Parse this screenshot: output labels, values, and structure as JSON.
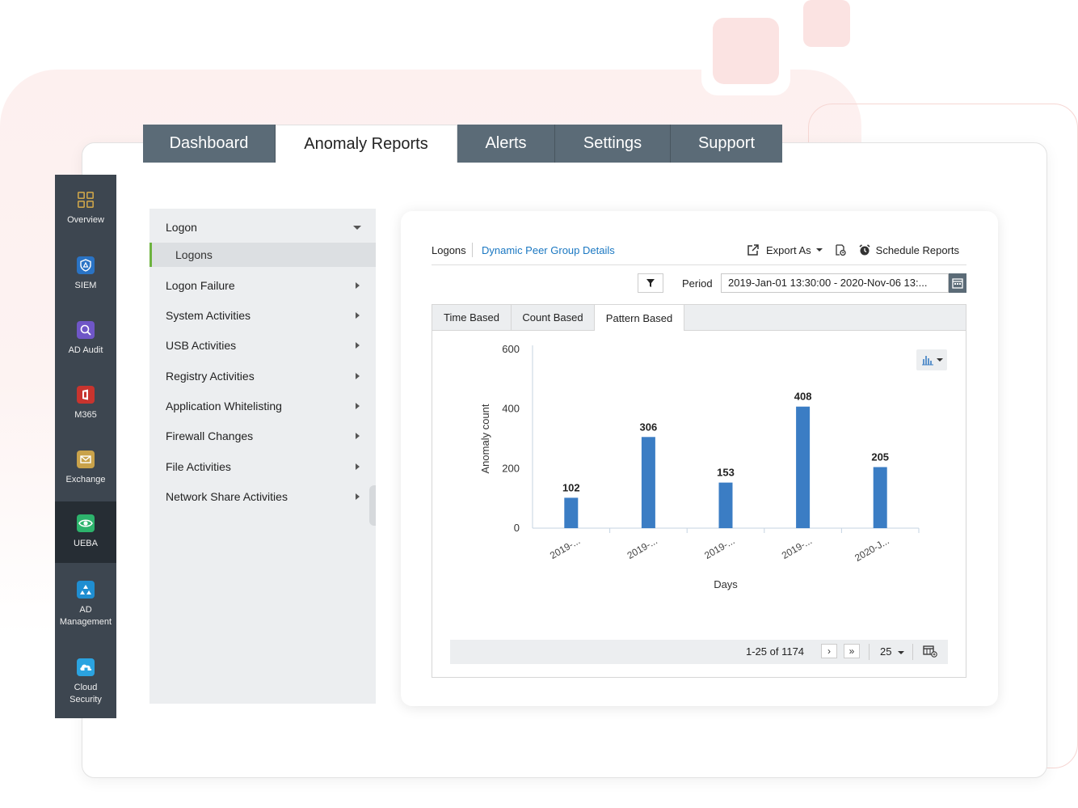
{
  "top_tabs": [
    {
      "label": "Dashboard"
    },
    {
      "label": "Anomaly Reports"
    },
    {
      "label": "Alerts"
    },
    {
      "label": "Settings"
    },
    {
      "label": "Support"
    }
  ],
  "rail": {
    "items": [
      {
        "label": "Overview",
        "icon": "overview-grid-icon"
      },
      {
        "label": "SIEM",
        "icon": "siem-shield-icon"
      },
      {
        "label": "AD Audit",
        "icon": "ad-audit-search-icon"
      },
      {
        "label": "M365",
        "icon": "m365-office-icon"
      },
      {
        "label": "Exchange",
        "icon": "exchange-mail-icon"
      },
      {
        "label": "UEBA",
        "icon": "ueba-eye-icon"
      },
      {
        "label": "AD Management",
        "line1": "AD",
        "line2": "Management",
        "icon": "ad-management-icon"
      },
      {
        "label": "Cloud Security",
        "line1": "Cloud",
        "line2": "Security",
        "icon": "cloud-security-icon"
      }
    ],
    "colors": {
      "overview": "#c9a24a",
      "siem": "#2a73c4",
      "ad_audit": "#6f56c7",
      "m365": "#c8342e",
      "exchange": "#c9a24a",
      "ueba": "#2db36c",
      "ad_management": "#1f8ed1",
      "cloud_security": "#2ba3e0"
    }
  },
  "nav": {
    "section": "Logon",
    "sub_item": "Logons",
    "items": [
      "Logon Failure",
      "System Activities",
      "USB Activities",
      "Registry Activities",
      "Application Whitelisting",
      "Firewall Changes",
      "File Activities",
      "Network Share Activities"
    ]
  },
  "report": {
    "crumb_current": "Logons",
    "crumb_link": "Dynamic Peer Group Details",
    "export_label": "Export As",
    "schedule_label": "Schedule Reports",
    "period_label": "Period",
    "period_value": "2019-Jan-01 13:30:00 - 2020-Nov-06 13:...",
    "sub_tabs": [
      "Time Based",
      "Count Based",
      "Pattern Based"
    ],
    "active_sub_tab": "Pattern Based",
    "pager_range": "1-25 of 1174",
    "page_size": "25"
  },
  "colors": {
    "accent": "#1b78c2",
    "bar": "#3b7dc4",
    "tab_bg": "#5b6b77",
    "rail_bg": "#3d4650",
    "active_indicator": "#6db33f"
  },
  "chart_data": {
    "type": "bar",
    "categories": [
      "2019-...",
      "2019-...",
      "2019-...",
      "2019-...",
      "2020-J..."
    ],
    "values": [
      102,
      306,
      153,
      408,
      205
    ],
    "xlabel": "Days",
    "ylabel": "Anomaly count",
    "ylim": [
      0,
      600
    ],
    "yticks": [
      0,
      200,
      400,
      600
    ],
    "grid": false,
    "data_labels": true
  }
}
